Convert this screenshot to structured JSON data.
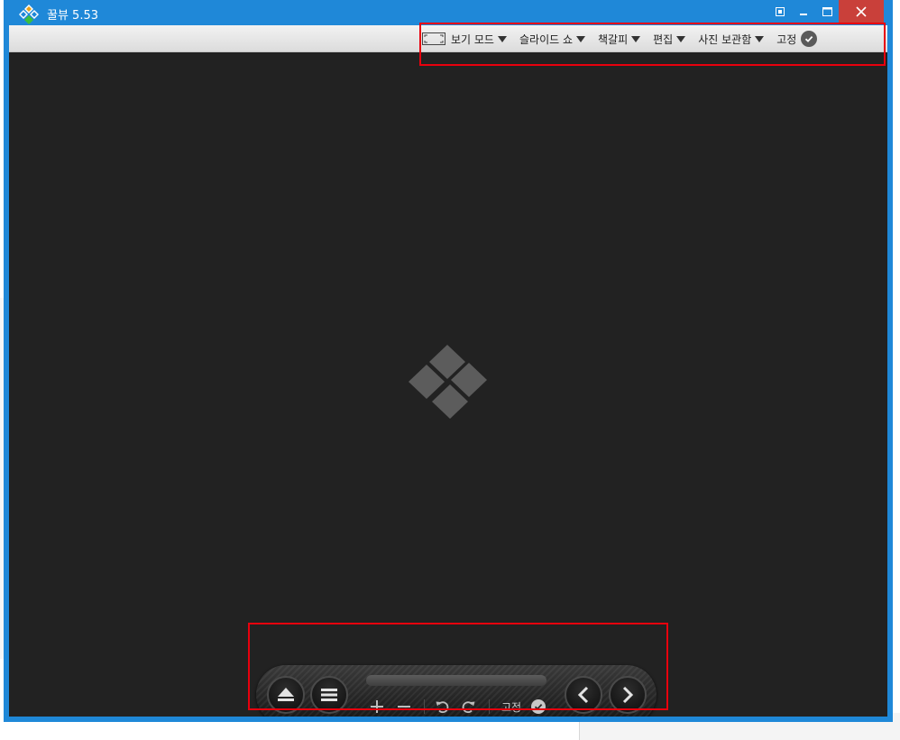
{
  "app": {
    "icon": "app-logo-icon",
    "title": "꿀뷰 5.53"
  },
  "window_controls": {
    "capture_icon": "capture-icon",
    "minimize_icon": "minimize-icon",
    "maximize_icon": "maximize-icon",
    "close_icon": "close-icon"
  },
  "menu": {
    "view_mode": "보기 모드",
    "slideshow": "슬라이드 쇼",
    "bookmark": "책갈피",
    "edit": "편집",
    "photo_box": "사진 보관함",
    "pin": "고정"
  },
  "controls": {
    "eject_icon": "eject-icon",
    "list_icon": "list-icon",
    "zoom_in_icon": "plus-icon",
    "zoom_out_icon": "minus-icon",
    "rotate_left_icon": "rotate-left-icon",
    "rotate_right_icon": "rotate-right-icon",
    "pin": "고정",
    "prev_icon": "chevron-left-icon",
    "next_icon": "chevron-right-icon"
  },
  "colors": {
    "titlebar": "#1f88d8",
    "close_button": "#c9403a",
    "viewer_background": "#222222",
    "highlight_box": "#e8000d"
  }
}
